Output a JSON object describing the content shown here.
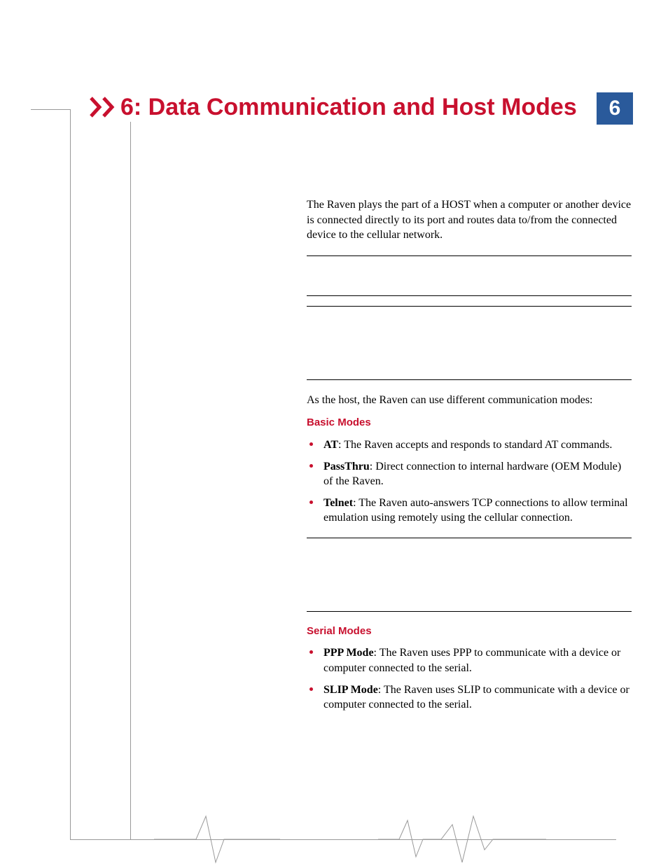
{
  "chapter": {
    "number": "6",
    "title": "6: Data Communication and Host Modes"
  },
  "intro": "The Raven plays the part of a HOST when a computer or another device is connected directly to its port and routes data to/from the connected device to the cellular network.",
  "para2": "As the host, the Raven can use different communication modes:",
  "basic": {
    "heading": "Basic Modes",
    "items": [
      {
        "term": "AT",
        "desc": ": The Raven accepts and responds to standard AT commands."
      },
      {
        "term": "PassThru",
        "desc": ": Direct connection to internal hardware (OEM Module) of the Raven."
      },
      {
        "term": "Telnet",
        "desc": ": The Raven auto-answers TCP connections to allow terminal emulation using remotely using the cellular connection."
      }
    ]
  },
  "serial": {
    "heading": "Serial Modes",
    "items": [
      {
        "term": "PPP Mode",
        "desc": ": The Raven uses PPP to communicate with a device or computer connected to the serial."
      },
      {
        "term": "SLIP Mode",
        "desc": ": The Raven uses SLIP to communicate with a device or computer connected to the serial."
      }
    ]
  }
}
